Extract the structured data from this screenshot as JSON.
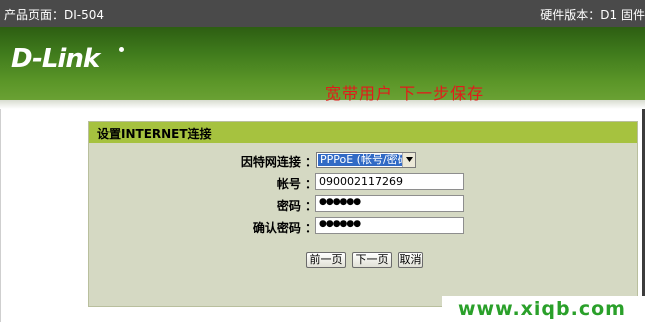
{
  "topbar": {
    "product_page": "产品页面：DI-504",
    "hardware_version": "硬件版本：D1  固件"
  },
  "brand": {
    "logo_text": "D-Link"
  },
  "annotation": {
    "text": "宽带用户   下一步保存"
  },
  "panel": {
    "title": "设置INTERNET连接",
    "fields": [
      {
        "label": "因特网连接 ：",
        "type": "select",
        "value": "PPPoE (帐号/密码)"
      },
      {
        "label": "帐号 ：",
        "type": "text",
        "value": "090002117269"
      },
      {
        "label": "密码 ：",
        "type": "password",
        "value": "●●●●●●"
      },
      {
        "label": "确认密码 ：",
        "type": "password",
        "value": "●●●●●●"
      }
    ],
    "buttons": {
      "prev": "前一页",
      "next": "下一页",
      "cancel": "取消"
    }
  },
  "watermark": {
    "text": "www.xiqb.com"
  },
  "colors": {
    "header_green": "#a6c23f",
    "panel_bg": "#d5d9c3",
    "annotation_red": "#e21b1b",
    "watermark_green": "#2aa02a"
  }
}
